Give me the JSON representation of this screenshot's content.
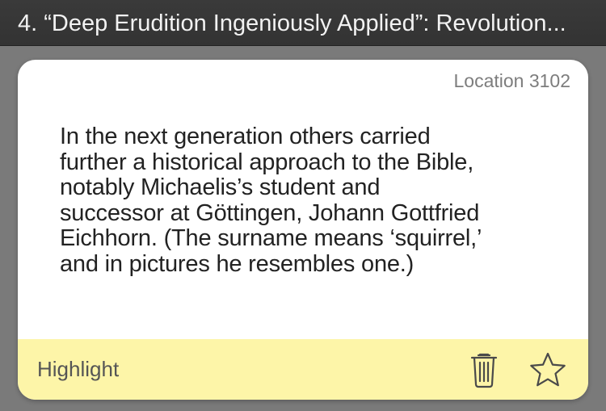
{
  "header": {
    "chapter_title": "4. “Deep Erudition Ingeniously Applied”: Revolution..."
  },
  "note": {
    "location": "Location 3102",
    "passage_lines": [
      "In the next generation others carried",
      "further a historical approach to the Bible,",
      "notably Michaelis’s student and",
      "successor at Göttingen, Johann Gottfried",
      "Eichhorn. (The surname means ‘squirrel,’",
      "and in pictures he resembles one.)"
    ],
    "type_label": "Highlight",
    "highlight_color": "#fdf5a8"
  },
  "actions": {
    "delete_icon": "trash-icon",
    "favorite_icon": "star-outline-icon"
  }
}
